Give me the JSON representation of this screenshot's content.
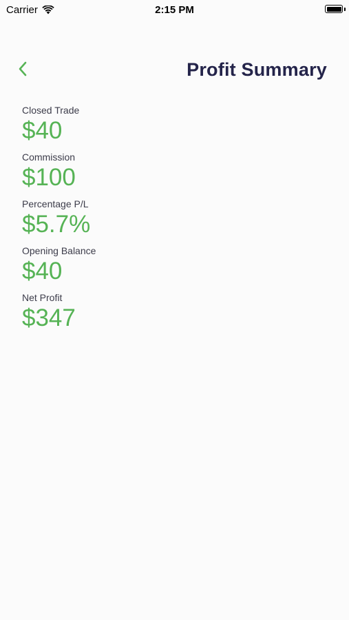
{
  "status_bar": {
    "carrier": "Carrier",
    "time": "2:15 PM"
  },
  "header": {
    "title": "Profit Summary",
    "back_icon": "chevron-left-icon",
    "accent_color": "#56b355",
    "title_color": "#24244a"
  },
  "metrics": [
    {
      "label": "Closed Trade",
      "value": "$40"
    },
    {
      "label": "Commission",
      "value": "$100"
    },
    {
      "label": "Percentage P/L",
      "value": "$5.7%"
    },
    {
      "label": "Opening Balance",
      "value": "$40"
    },
    {
      "label": "Net Profit",
      "value": "$347"
    }
  ]
}
